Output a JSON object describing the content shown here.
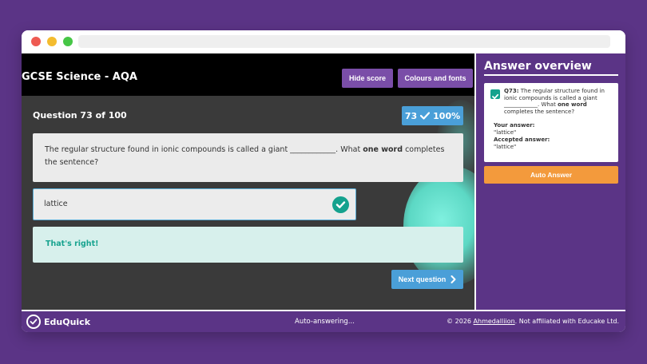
{
  "header": {
    "title": "GCSE Science - AQA",
    "hide_score_label": "Hide score",
    "colours_fonts_label": "Colours and fonts"
  },
  "question": {
    "counter": "Question 73 of 100",
    "score_count": "73",
    "score_percent": "100%",
    "text_before": "The regular structure found in ionic compounds is called a giant ____________. What ",
    "text_bold": "one word",
    "text_after": " completes the sentence?"
  },
  "answer": {
    "value": "lattice",
    "feedback": "That's right!"
  },
  "next_label": "Next question",
  "panel": {
    "title": "Answer overview",
    "q_number": "Q73:",
    "q_text_before": " The regular structure found in ionic compounds is called a giant ____________. What ",
    "q_text_bold": "one word",
    "q_text_after": " completes the sentence?",
    "your_answer_label": "Your answer:",
    "your_answer_value": "\"lattice\"",
    "accepted_label": "Accepted answer:",
    "accepted_value": "\"lattice\"",
    "auto_answer_label": "Auto Answer"
  },
  "footer": {
    "brand": "EduQuick",
    "status": "Auto-answering...",
    "credit_prefix": "© 2026 ",
    "credit_author": "Ahmedalliion",
    "credit_suffix": ". Not affiliated with Educake Ltd."
  },
  "colors": {
    "brand_purple": "#5b3486",
    "accent_blue": "#4a9fd8",
    "success_teal": "#15a28e",
    "auto_orange": "#f39a3c"
  }
}
